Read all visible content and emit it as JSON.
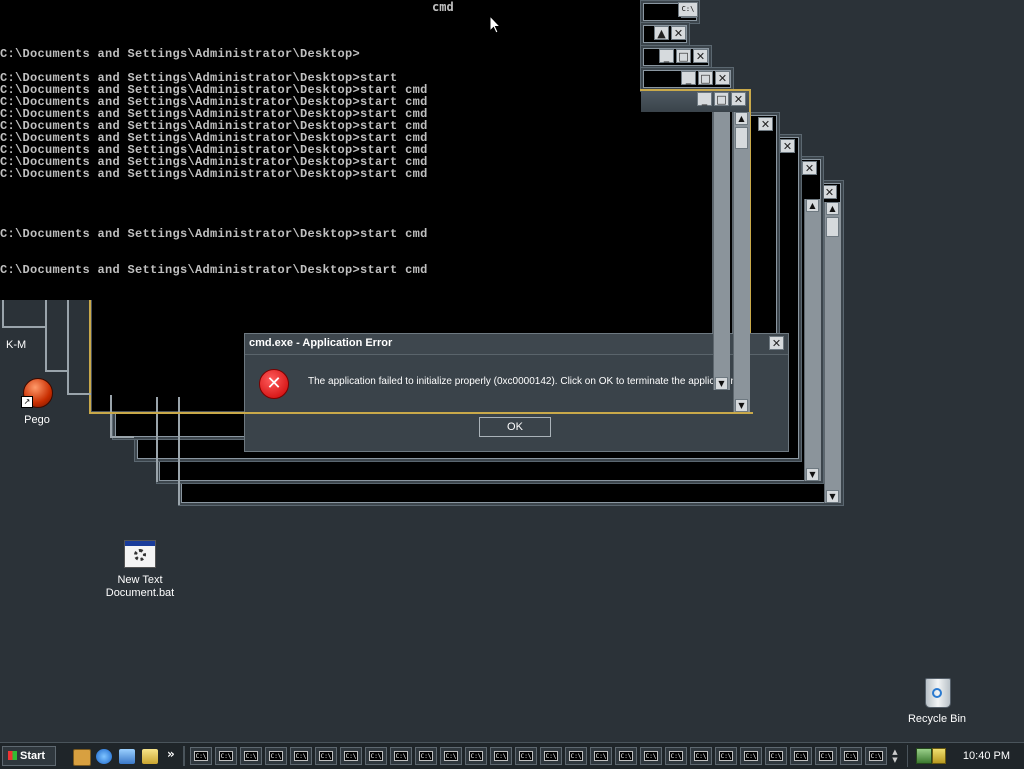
{
  "console": {
    "title": "cmd",
    "lines": [
      "C:\\Documents and Settings\\Administrator\\Desktop>",
      "C:\\Documents and Settings\\Administrator\\Desktop>start",
      "C:\\Documents and Settings\\Administrator\\Desktop>start cmd",
      "C:\\Documents and Settings\\Administrator\\Desktop>start cmd",
      "C:\\Documents and Settings\\Administrator\\Desktop>start cmd",
      "C:\\Documents and Settings\\Administrator\\Desktop>start cmd",
      "C:\\Documents and Settings\\Administrator\\Desktop>start cmd",
      "C:\\Documents and Settings\\Administrator\\Desktop>start cmd",
      "C:\\Documents and Settings\\Administrator\\Desktop>start cmd",
      "C:\\Documents and Settings\\Administrator\\Desktop>start cmd",
      "C:\\Documents and Settings\\Administrator\\Desktop>start cmd",
      "C:\\Documents and Settings\\Administrator\\Desktop>start cmd"
    ]
  },
  "cmd_window_tag": "C:\\",
  "error_dialog": {
    "title": "cmd.exe - Application Error",
    "message": "The application failed to initialize properly (0xc0000142). Click on OK to terminate the application.",
    "ok_label": "OK",
    "close_label": "✕",
    "icon": "error-x-icon"
  },
  "desktop": {
    "icons": [
      {
        "label": "K-M",
        "icon": "shortcut-icon"
      },
      {
        "label": "Pego",
        "icon": "red-ball-icon"
      },
      {
        "label": "New Text Document.bat",
        "icon": "batch-file-icon"
      },
      {
        "label": "Recycle Bin",
        "icon": "recycle-bin-icon"
      }
    ]
  },
  "taskbar": {
    "start_label": "Start",
    "quick_launch": [
      "show-desktop-icon",
      "internet-explorer-icon",
      "outlook-express-icon",
      "windows-media-icon"
    ],
    "chevron": "»",
    "task_button_label": "C:\\",
    "task_button_count": 28,
    "clock": "10:40 PM"
  },
  "colors": {
    "desktop": "#2b3238",
    "console_bg": "#000000",
    "console_text": "#c0c0c0",
    "focus_border": "#c9a94a",
    "error_red": "#e00000"
  }
}
